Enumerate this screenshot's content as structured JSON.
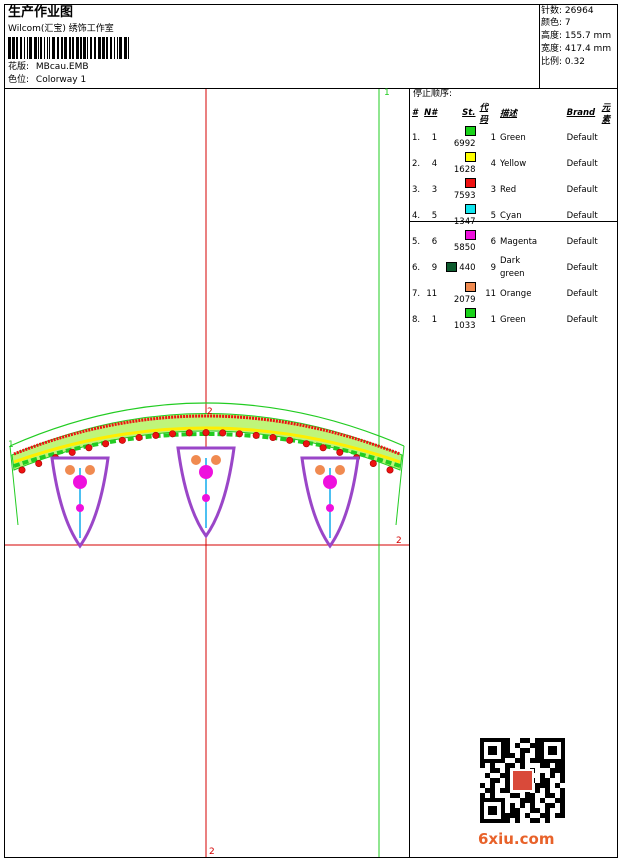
{
  "header": {
    "title": "生产作业图",
    "company": "Wilcom(汇宝) 绣饰工作室",
    "design_label": "花版:",
    "design_value": "MBcau.EMB",
    "colorway_label": "色位:",
    "colorway_value": "Colorway 1"
  },
  "meta": [
    {
      "label": "针数:",
      "value": "26964"
    },
    {
      "label": "颜色:",
      "value": "7"
    },
    {
      "label": "高度:",
      "value": "155.7 mm"
    },
    {
      "label": "宽度:",
      "value": "417.4 mm"
    },
    {
      "label": "比例:",
      "value": "0.32"
    }
  ],
  "stop_sequence": {
    "title": "停止顺序:",
    "headers": {
      "idx": "#",
      "no": "N#",
      "st": "St.",
      "code": "代码",
      "desc": "描述",
      "brand": "Brand",
      "element": "元素"
    },
    "rows": [
      {
        "idx": "1.",
        "no": "1",
        "color": "#19d219",
        "st": "6992",
        "code": "1",
        "desc": "Green",
        "brand": "Default"
      },
      {
        "idx": "2.",
        "no": "4",
        "color": "#ffff00",
        "st": "1628",
        "code": "4",
        "desc": "Yellow",
        "brand": "Default"
      },
      {
        "idx": "3.",
        "no": "3",
        "color": "#ee1111",
        "st": "7593",
        "code": "3",
        "desc": "Red",
        "brand": "Default"
      },
      {
        "idx": "4.",
        "no": "5",
        "color": "#11e5ee",
        "st": "1347",
        "code": "5",
        "desc": "Cyan",
        "brand": "Default"
      },
      {
        "idx": "5.",
        "no": "6",
        "color": "#ee11dd",
        "st": "5850",
        "code": "6",
        "desc": "Magenta",
        "brand": "Default"
      },
      {
        "idx": "6.",
        "no": "9",
        "color": "#0d5b2e",
        "st": "440",
        "code": "9",
        "desc": "Dark green",
        "brand": "Default"
      },
      {
        "idx": "7.",
        "no": "11",
        "color": "#f08a50",
        "st": "2079",
        "code": "11",
        "desc": "Orange",
        "brand": "Default"
      },
      {
        "idx": "8.",
        "no": "1",
        "color": "#19d219",
        "st": "1033",
        "code": "1",
        "desc": "Green",
        "brand": "Default"
      }
    ]
  },
  "axes": {
    "label_1": "1",
    "label_2": "2"
  },
  "colors": {
    "axis_red": "#d40000",
    "axis_green": "#22cc22",
    "brand_orange": "#e8622a"
  },
  "watermark": {
    "text": "6xiu.com"
  }
}
